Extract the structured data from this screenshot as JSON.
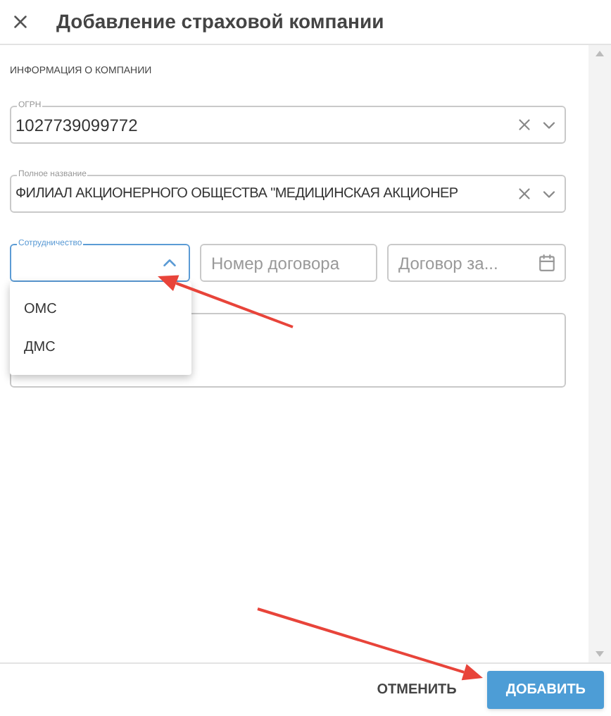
{
  "dialog": {
    "title": "Добавление страховой компании"
  },
  "section_title": "ИНФОРМАЦИЯ О КОМПАНИИ",
  "ogrn": {
    "label": "ОГРН",
    "value": "1027739099772"
  },
  "full_name": {
    "label": "Полное название",
    "value": "ФИЛИАЛ АКЦИОНЕРНОГО ОБЩЕСТВА \"МЕДИЦИНСКАЯ АКЦИОНЕР"
  },
  "cooperation": {
    "label": "Сотрудничество",
    "expanded": true,
    "options": [
      {
        "label": "ОМС"
      },
      {
        "label": "ДМС"
      }
    ]
  },
  "contract_number": {
    "placeholder": "Номер договора"
  },
  "contract_date": {
    "placeholder": "Договор за..."
  },
  "buttons": [
    {
      "label": "ОТМЕНИТЬ",
      "kind": "text"
    },
    {
      "label": "ДОБАВИТЬ",
      "kind": "primary"
    }
  ]
}
